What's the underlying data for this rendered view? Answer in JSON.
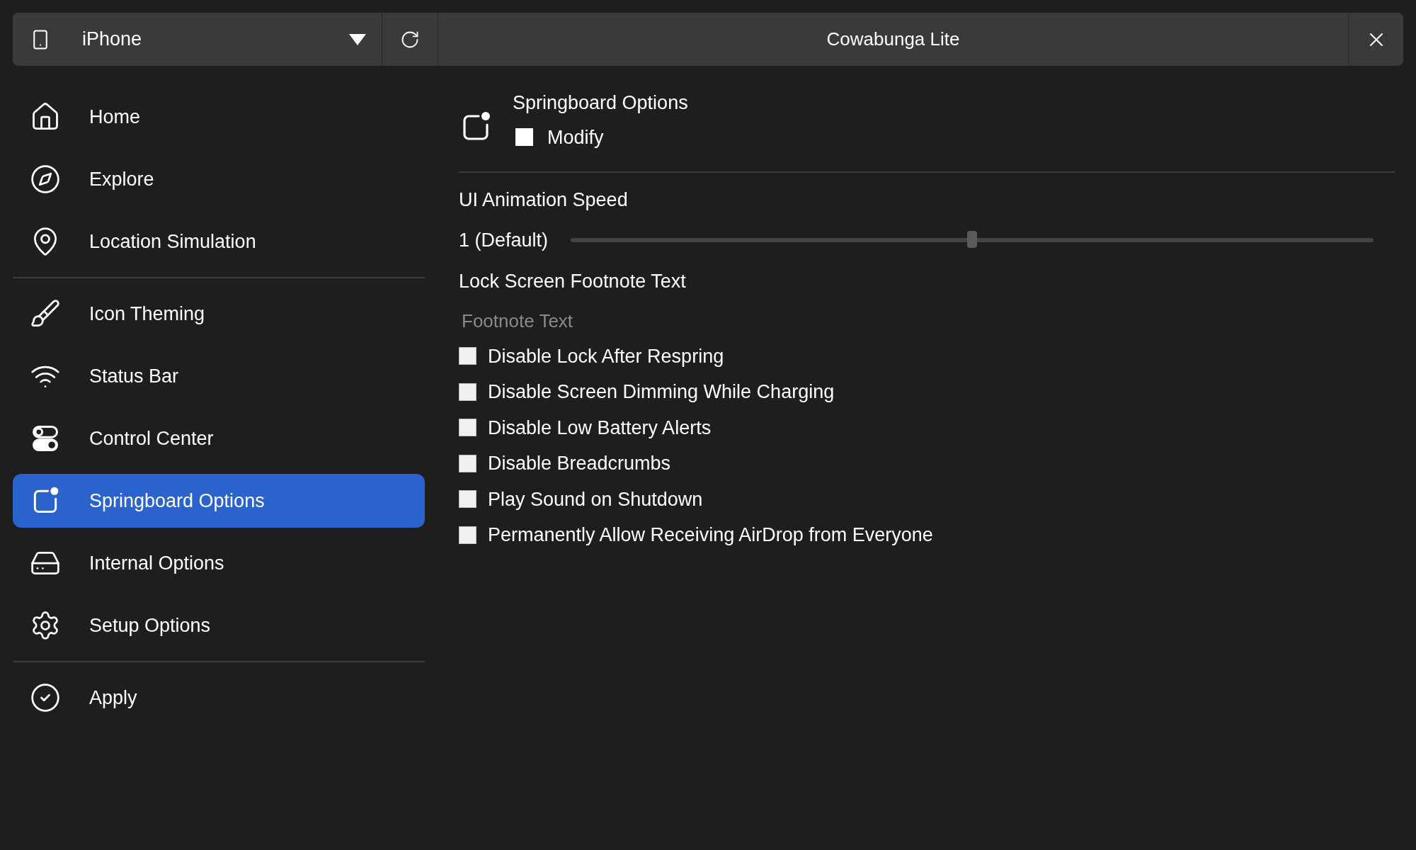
{
  "window": {
    "title": "Cowabunga Lite"
  },
  "device_picker": {
    "value": "iPhone"
  },
  "sidebar": {
    "groups": [
      {
        "items": [
          {
            "label": "Home",
            "selected": false
          },
          {
            "label": "Explore",
            "selected": false
          },
          {
            "label": "Location Simulation",
            "selected": false
          }
        ]
      },
      {
        "items": [
          {
            "label": "Icon Theming",
            "selected": false
          },
          {
            "label": "Status Bar",
            "selected": false
          },
          {
            "label": "Control Center",
            "selected": false
          },
          {
            "label": "Springboard Options",
            "selected": true
          },
          {
            "label": "Internal Options",
            "selected": false
          },
          {
            "label": "Setup Options",
            "selected": false
          }
        ]
      },
      {
        "items": [
          {
            "label": "Apply",
            "selected": false
          }
        ]
      }
    ]
  },
  "page": {
    "title": "Springboard Options",
    "modify": {
      "label": "Modify",
      "checked": false
    },
    "animation_speed": {
      "label": "UI Animation Speed",
      "reading": "1 (Default)",
      "level": 0.5
    },
    "footnote": {
      "label": "Lock Screen Footnote Text",
      "placeholder": "Footnote Text"
    },
    "options": [
      {
        "label": "Disable Lock After Respring",
        "checked": false
      },
      {
        "label": "Disable Screen Dimming While Charging",
        "checked": false
      },
      {
        "label": "Disable Low Battery Alerts",
        "checked": false
      },
      {
        "label": "Disable Breadcrumbs",
        "checked": false
      },
      {
        "label": "Play Sound on Shutdown",
        "checked": false
      },
      {
        "label": "Permanently Allow Receiving AirDrop from Everyone",
        "checked": false
      }
    ]
  }
}
